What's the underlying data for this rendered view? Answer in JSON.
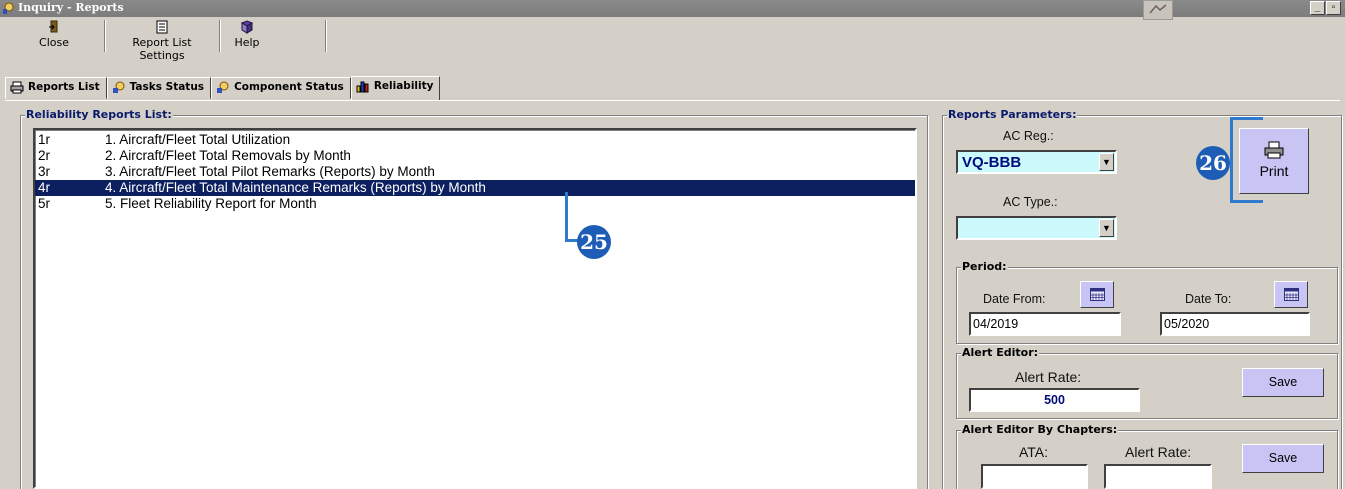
{
  "window": {
    "title": "Inquiry - Reports",
    "minimize_glyph": "_",
    "restore_glyph": "▫"
  },
  "toolbar": {
    "close_label": "Close",
    "settings_label": "Report List Settings",
    "help_label": "Help"
  },
  "tabs": [
    {
      "label": "Reports List",
      "icon": "printer-icon",
      "active": false
    },
    {
      "label": "Tasks Status",
      "icon": "status-icon",
      "active": false
    },
    {
      "label": "Component Status",
      "icon": "status-icon",
      "active": false
    },
    {
      "label": "Reliability",
      "icon": "chart-icon",
      "active": true
    }
  ],
  "reports_list": {
    "title": "Reliability Reports List:",
    "items": [
      {
        "code": "1r",
        "name": "1. Aircraft/Fleet Total Utilization",
        "selected": false
      },
      {
        "code": "2r",
        "name": "2. Aircraft/Fleet Total Removals by Month",
        "selected": false
      },
      {
        "code": "3r",
        "name": "3. Aircraft/Fleet Total Pilot Remarks (Reports) by Month",
        "selected": false
      },
      {
        "code": "4r",
        "name": "4. Aircraft/Fleet Total Maintenance Remarks (Reports) by Month",
        "selected": true
      },
      {
        "code": "5r",
        "name": "5. Fleet Reliability Report for Month",
        "selected": false
      }
    ]
  },
  "parameters": {
    "title": "Reports Parameters:",
    "ac_reg_label": "AC Reg.:",
    "ac_reg_value": "VQ-BBB",
    "ac_type_label": "AC Type.:",
    "ac_type_value": "",
    "print_label": "Print"
  },
  "period": {
    "title": "Period:",
    "date_from_label": "Date From:",
    "date_from_value": "04/2019",
    "date_to_label": "Date To:",
    "date_to_value": "05/2020"
  },
  "alert_editor": {
    "title": "Alert Editor:",
    "rate_label": "Alert Rate:",
    "rate_value": "500",
    "save_label": "Save"
  },
  "alert_chapters": {
    "title": "Alert Editor By Chapters:",
    "ata_label": "ATA:",
    "rate_label": "Alert Rate:",
    "save_label": "Save"
  },
  "callouts": {
    "a": "25",
    "b": "26"
  },
  "colors": {
    "selection": "#0c1f5f",
    "accent_button": "#c8c4f4",
    "combo_fill": "#ccf9fb",
    "callout": "#1e5db5"
  }
}
